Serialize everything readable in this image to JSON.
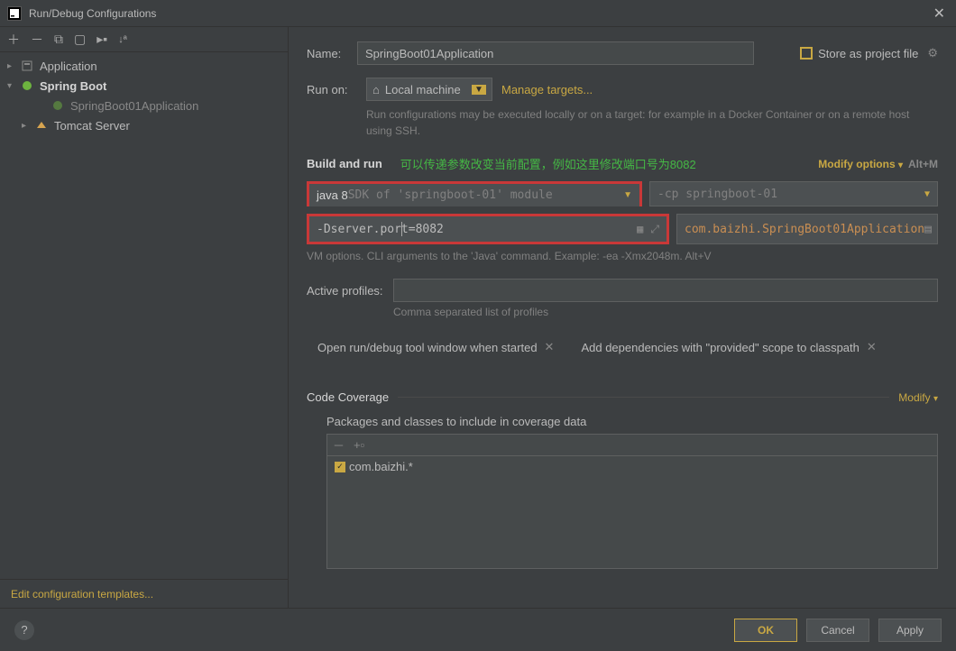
{
  "window": {
    "title": "Run/Debug Configurations"
  },
  "tree": {
    "application": "Application",
    "springboot": "Spring Boot",
    "springbootapp": "SpringBoot01Application",
    "tomcat": "Tomcat Server"
  },
  "sidebar": {
    "edit_templates": "Edit configuration templates..."
  },
  "form": {
    "name_label": "Name:",
    "name_value": "SpringBoot01Application",
    "store_as_file": "Store as project file",
    "runon_label": "Run on:",
    "runon_value": "Local machine",
    "manage_targets": "Manage targets...",
    "runon_hint": "Run configurations may be executed locally or on a target: for example in a Docker Container or on a remote host using SSH.",
    "build_title": "Build and run",
    "annotation": "可以传递参数改变当前配置，例如这里修改端口号为8082",
    "modify_options": "Modify options",
    "altm": "Alt+M",
    "sdk_bold": "java 8",
    "sdk_gray": " SDK of 'springboot-01' module",
    "cp_text": "-cp springboot-01",
    "vm_value": "-Dserver.port=8082",
    "main_class": "com.baizhi.SpringBoot01Application",
    "vm_hint": "VM options. CLI arguments to the 'Java' command. Example: -ea -Xmx2048m. Alt+V",
    "profiles_label": "Active profiles:",
    "profiles_hint": "Comma separated list of profiles",
    "chip1": "Open run/debug tool window when started",
    "chip2": "Add dependencies with \"provided\" scope to classpath",
    "coverage_title": "Code Coverage",
    "modify": "Modify",
    "coverage_sub": "Packages and classes to include in coverage data",
    "coverage_item": "com.baizhi.*"
  },
  "footer": {
    "ok": "OK",
    "cancel": "Cancel",
    "apply": "Apply"
  }
}
